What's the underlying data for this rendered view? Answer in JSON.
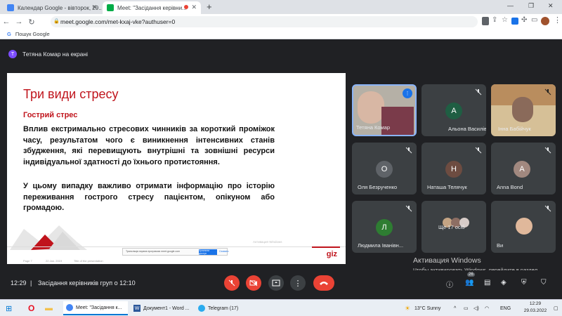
{
  "browser": {
    "tabs": [
      {
        "title": "Календар Google - вівторок, 29..."
      },
      {
        "title": "Meet: \"Засідання керівни..."
      }
    ],
    "url": "meet.google.com/met-kxaj-vke?authuser=0",
    "bookmark": "Пошук Google"
  },
  "meet": {
    "presenter": "Тетяна Комар на екрані",
    "presenter_initial": "Т",
    "time": "12:29",
    "separator": "|",
    "meeting_title": "Засідання керівників груп о 12:10",
    "participants": [
      {
        "name": "Тетяна Комар",
        "initial": ""
      },
      {
        "name": "Альона Василівна",
        "initial": "А"
      },
      {
        "name": "Інна Бабійчук",
        "initial": ""
      },
      {
        "name": "Оля Безрученко",
        "initial": "О"
      },
      {
        "name": "Наташа Телячук",
        "initial": "Н"
      },
      {
        "name": "Anna Bond",
        "initial": "A"
      },
      {
        "name": "Людмила Іванівн...",
        "initial": "Л"
      },
      {
        "name": "Ще 17 осіб",
        "initial": ""
      },
      {
        "name": "Ви",
        "initial": ""
      }
    ],
    "participants_count": "26"
  },
  "slide": {
    "title": "Три види стресу",
    "subtitle": "Гострий стрес",
    "paragraph1": "Вплив екстримально стресових чинників за короткий проміжок часу, результатом чого є виникнення інтенсивних станів збудження, які перевищують внутрішні та зовнішні ресурси індивідуальної здатності до їхнього протистояння.",
    "paragraph2": "У цьому випадку важливо отримати інформацію про історію переживання гострого стресу пацієнтом, опікуном або громадою.",
    "footer_page": "Page 7",
    "footer_date": "22 Jan. 2019",
    "footer_title": "Title of the presentation",
    "logo": "giz",
    "share_notice": "Трансляція екрана програмою meet.google.com",
    "share_stop": "Зупинити доступ",
    "share_hide": "Сховати"
  },
  "windows_watermark": {
    "line1": "Активация Windows",
    "line2": "Чтобы активировать Windows, перейдите в раздел \"Параметры\"."
  },
  "taskbar": {
    "items": [
      "Meet: \"Засідання к...",
      "Документ1 - Word ...",
      "Telegram (17)"
    ],
    "weather": "13°C  Sunny",
    "lang": "ENG",
    "clock_time": "12:29",
    "clock_date": "29.03.2022"
  },
  "colors": {
    "accent_red": "#c0141c",
    "end_call": "#ea4335",
    "meet_bg": "#202124",
    "tile_bg": "#3c4043",
    "active_speaker": "#8ab4f8"
  }
}
